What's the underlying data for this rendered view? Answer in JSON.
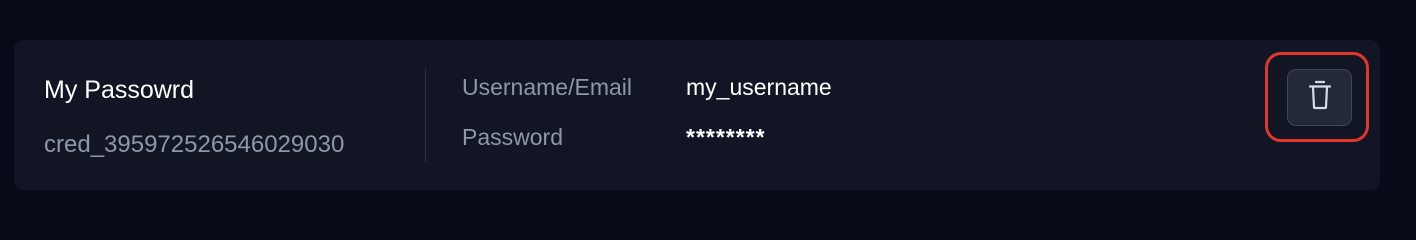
{
  "credential": {
    "name": "My Passowrd",
    "id": "cred_395972526546029030",
    "fields": [
      {
        "label": "Username/Email",
        "value": "my_username"
      },
      {
        "label": "Password",
        "value": "********"
      }
    ]
  },
  "actions": {
    "delete_icon": "trash-icon"
  },
  "colors": {
    "background": "#070b17",
    "card": "#121624",
    "muted_text": "#8e96aa",
    "highlight": "#e0362b"
  }
}
